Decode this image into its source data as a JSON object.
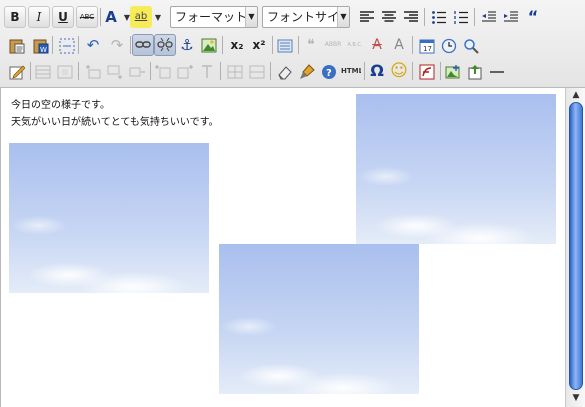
{
  "toolbar": {
    "format_combo": "フォーマット",
    "fontsize_combo": "フォントサイズ",
    "bold": "B",
    "italic": "I",
    "underline": "U",
    "strike": "ABC",
    "font_color": "A",
    "highlight": "ab",
    "subscript": "x₂",
    "superscript": "x²",
    "omega": "Ω",
    "html": "HTML",
    "abbr": "ABBR",
    "acronym": "A.B.C.",
    "blockquote": "“",
    "help": "?",
    "smiley": "☺"
  },
  "editor": {
    "line1": "今日の空の様子です。",
    "line2": "天気がいい日が続いてとても気持ちいいです。"
  },
  "scrollbar": {
    "up": "▲",
    "down": "▼"
  }
}
